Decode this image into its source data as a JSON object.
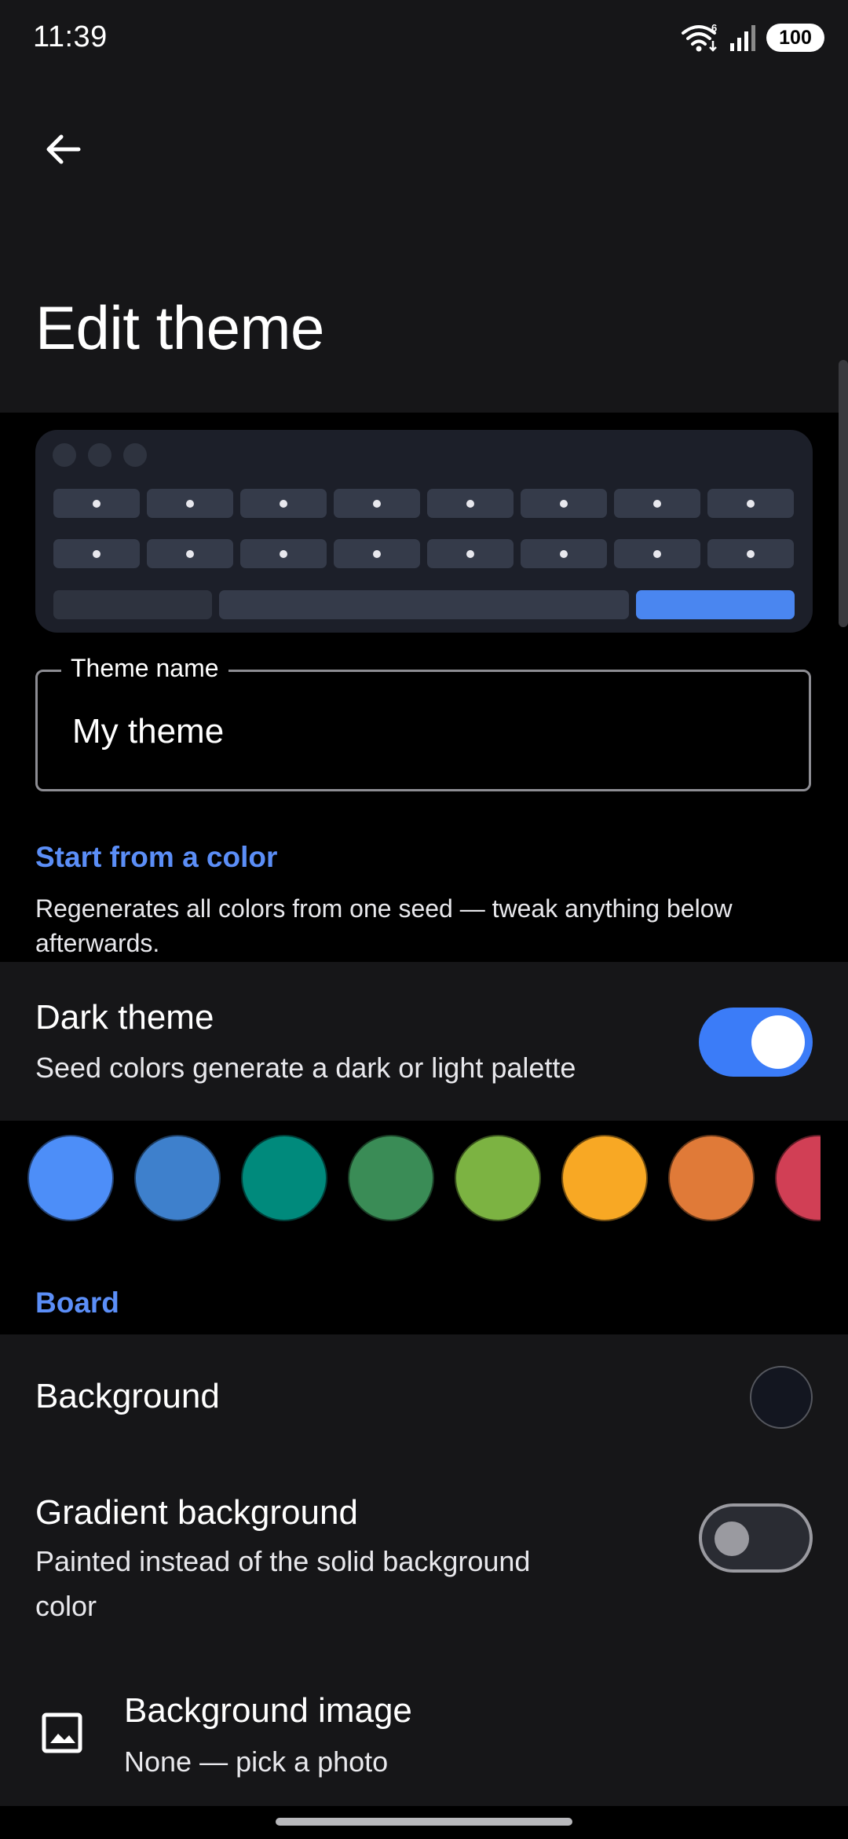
{
  "status_bar": {
    "time": "11:39",
    "battery": "100",
    "wifi_icon": "wifi-icon",
    "signal_icon": "signal-icon"
  },
  "header": {
    "back_icon": "arrow-left-icon",
    "title": "Edit theme"
  },
  "preview": {
    "key_color": "#353b4a",
    "accent_color": "#4a86f0"
  },
  "theme_name": {
    "label": "Theme name",
    "value": "My theme"
  },
  "seed_section": {
    "title": "Start from a color",
    "description": "Regenerates all colors from one seed — tweak anything below afterwards."
  },
  "dark_theme": {
    "title": "Dark theme",
    "subtitle": "Seed colors generate a dark or light palette",
    "enabled": true
  },
  "swatches": [
    "#4d8ef8",
    "#3e80cc",
    "#008a7c",
    "#3a8c56",
    "#7cb342",
    "#f8a824",
    "#e07a38",
    "#d13f55"
  ],
  "board_section": {
    "title": "Board"
  },
  "background_row": {
    "title": "Background",
    "color": "#131620"
  },
  "gradient_row": {
    "title": "Gradient background",
    "subtitle_line1": "Painted instead of the solid background",
    "subtitle_line2": "color",
    "enabled": false
  },
  "background_image_row": {
    "icon": "image-icon",
    "title": "Background image",
    "subtitle": "None — pick a photo"
  }
}
